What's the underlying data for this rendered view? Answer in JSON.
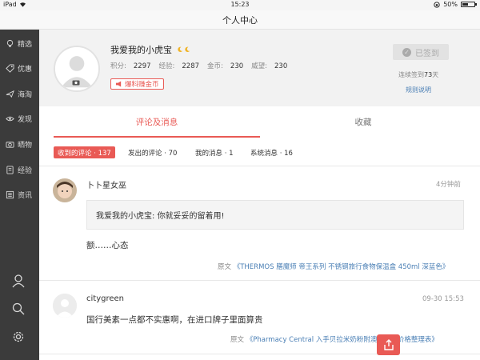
{
  "status_bar": {
    "device": "iPad",
    "time": "15:23",
    "battery": "50%",
    "battery_level": 0.5
  },
  "nav": {
    "title": "个人中心"
  },
  "sidebar": {
    "items": [
      {
        "label": "精选",
        "icon": "lightbulb-icon"
      },
      {
        "label": "优惠",
        "icon": "tag-icon"
      },
      {
        "label": "海淘",
        "icon": "plane-icon"
      },
      {
        "label": "发现",
        "icon": "eye-icon"
      },
      {
        "label": "晒物",
        "icon": "camera-icon"
      },
      {
        "label": "经验",
        "icon": "book-icon"
      },
      {
        "label": "资讯",
        "icon": "news-icon"
      }
    ],
    "bottom": [
      "user-icon",
      "search-icon",
      "gear-icon"
    ]
  },
  "profile": {
    "username": "我爱我的小虎宝",
    "stats": [
      {
        "label": "积分:",
        "value": "2297"
      },
      {
        "label": "经验:",
        "value": "2287"
      },
      {
        "label": "金币:",
        "value": "230"
      },
      {
        "label": "威望:",
        "value": "230"
      }
    ],
    "baoliao_label": "爆料赚金币",
    "signin_label": "已签到",
    "streak_prefix": "连续签到",
    "streak_days": "73",
    "streak_suffix": "天",
    "rules_label": "规则说明"
  },
  "tabs": [
    {
      "label": "评论及消息",
      "active": true
    },
    {
      "label": "收藏",
      "active": false
    }
  ],
  "filters": [
    {
      "label": "收到的评论 · 137",
      "active": true
    },
    {
      "label": "发出的评论 · 70",
      "active": false
    },
    {
      "label": "我的消息 · 1",
      "active": false
    },
    {
      "label": "系统消息 · 16",
      "active": false
    }
  ],
  "comments": [
    {
      "name": "卜卜星女巫",
      "time": "4分钟前",
      "quote": "我爱我的小虎宝: 你就妥妥的留着用!",
      "text": "额……心态",
      "source_prefix": "原文",
      "source_title": "《THERMOS 膳魔师 帝王系列 不锈钢旅行食物保温盒 450ml 深蓝色》"
    },
    {
      "name": "citygreen",
      "time": "09-30 15:53",
      "text": "国行美素一点都不实惠啊，在进口牌子里面算贵",
      "source_prefix": "原文",
      "source_title": "《Pharmacy Central 入手贝拉米奶粉附澳洲药房价格整理表》"
    }
  ],
  "colors": {
    "accent": "#e95a55",
    "sidebar_bg": "#3b3b3b",
    "link": "#4a7fb5"
  }
}
